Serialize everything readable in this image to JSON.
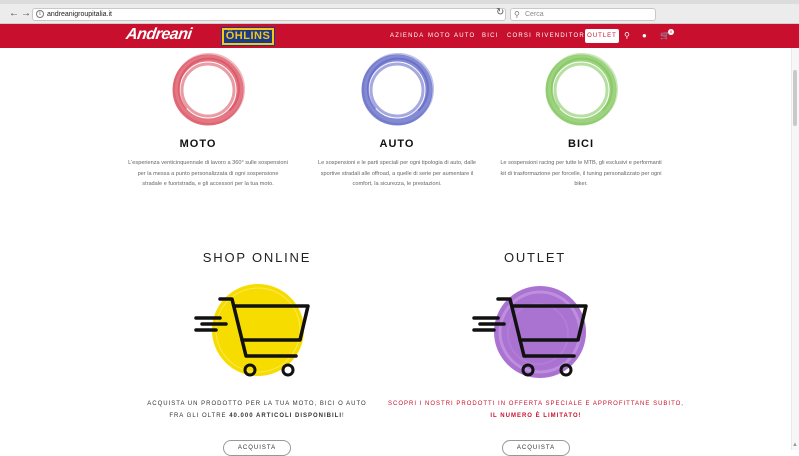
{
  "browser": {
    "url": "andreanigroupitalia.it",
    "search_placeholder": "Cerca"
  },
  "header": {
    "brand": "Andreani",
    "partner_logo": "ÖHLINS",
    "menu": [
      "AZIENDA",
      "MOTO",
      "AUTO",
      "BICI",
      "CORSI",
      "RIVENDITORI"
    ],
    "outlet": "OUTLET",
    "cart_count": "0"
  },
  "categories": [
    {
      "title": "MOTO",
      "color": "#d94a5a",
      "lines": [
        "L'esperienza venticinquennale di lavoro a 360° sulle sospensioni",
        "per la messa a punto personalizzata di ogni sospensione",
        "stradale e fuoristrada, e gli accessori per la tua moto."
      ]
    },
    {
      "title": "AUTO",
      "color": "#5b63c4",
      "lines": [
        "Le sospensioni e le parti speciali per ogni tipologia di auto, dalle",
        "sportive stradali alle offroad, a quelle di serie per aumentare il",
        "comfort, la sicurezza, le prestazioni."
      ]
    },
    {
      "title": "BICI",
      "color": "#7cc456",
      "lines": [
        "Le sospensioni racing per tutte le MTB, gli esclusivi e performanti",
        "kit di trasformazione per forcelle, il tuning personalizzato per ogni",
        "biker."
      ]
    }
  ],
  "shop": {
    "title": "SHOP ONLINE",
    "line1": "ACQUISTA UN PRODOTTO PER LA TUA MOTO, BICI O AUTO",
    "line2_pre": "FRA GLI OLTRE ",
    "line2_bold": "40.000 ARTICOLI DISPONIBILI",
    "line2_post": "!",
    "button": "ACQUISTA",
    "accent": "#f7dc00"
  },
  "outlet": {
    "title": "OUTLET",
    "line1": "SCOPRI I NOSTRI PRODOTTI IN OFFERTA SPECIALE E APPROFITTANE SUBITO,",
    "line2": "IL NUMERO È LIMITATO!",
    "button": "ACQUISTA",
    "accent": "#9b59c9",
    "text_color": "#c8102e"
  }
}
